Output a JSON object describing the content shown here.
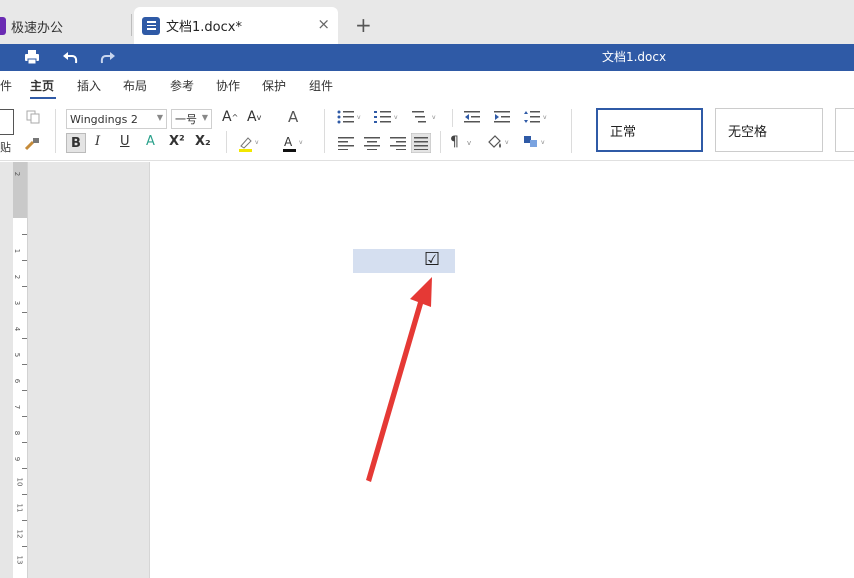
{
  "tabs": {
    "home_label": "极速办公",
    "doc_label": "文档1.docx*",
    "close_glyph": "×",
    "new_glyph": "+"
  },
  "titlebar": {
    "doc_title": "文档1.docx",
    "color": "#2f5aa6"
  },
  "menu": {
    "items": [
      "件",
      "主页",
      "插入",
      "布局",
      "参考",
      "协作",
      "保护",
      "组件"
    ],
    "active": "主页"
  },
  "ribbon": {
    "paste_label": "贴",
    "font_name": "Wingdings 2",
    "font_size": "一号",
    "bold": "B",
    "italic": "I",
    "underline": "U",
    "strike": "A",
    "superscript": "X²",
    "subscript": "X₂",
    "pilcrow": "¶",
    "styles": [
      "正常",
      "无空格"
    ]
  },
  "ruler": {
    "numbers": [
      "2",
      "1",
      "2",
      "3",
      "4",
      "5",
      "6",
      "7",
      "8",
      "9",
      "10",
      "11",
      "12",
      "13"
    ]
  },
  "document": {
    "checkbox_char": "☑"
  },
  "annotation": {
    "arrow_color": "#e53935"
  }
}
